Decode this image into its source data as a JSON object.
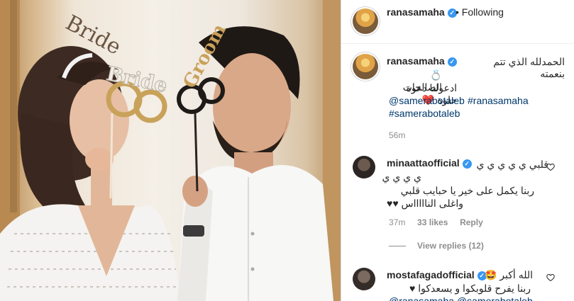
{
  "post": {
    "author": "ranasamaha",
    "follow_state": "Following",
    "caption": {
      "line1": "الحمدلله الذي تتم بنعمته",
      "line2": "💍 الصالحات",
      "line3": "ادعولنا دعوة حلوة ❤️",
      "mention": "@samerabotaleb",
      "hashtag1": "#ranasamaha",
      "hashtag2": "#samerabotaleb",
      "time": "56m"
    },
    "photo_props": {
      "bride_sign": "Bride",
      "groom_sign": "Groom"
    }
  },
  "comments": [
    {
      "username": "minaattaofficial",
      "lines": [
        "قلبي ي ي ي ي ي",
        "ي ي ي ي",
        "ربنا يكمل على خير يا حبايب قلبي",
        "واغلى الناااااس ♥♥"
      ],
      "time": "37m",
      "likes": "33 likes",
      "reply": "Reply",
      "view_replies": "View replies (12)"
    },
    {
      "username": "mostafagadofficial",
      "lines": [
        "الله أكبر 🤩",
        "ربنا يفرح قلوبكوا و يسعدكوا ♥",
        "@ranasamaha @samerabotaleb"
      ]
    }
  ],
  "colors": {
    "link": "#00376b",
    "verified": "#3897f0",
    "muted": "#8e8e8e"
  },
  "icons": [
    "verified-badge-icon",
    "heart-icon"
  ]
}
